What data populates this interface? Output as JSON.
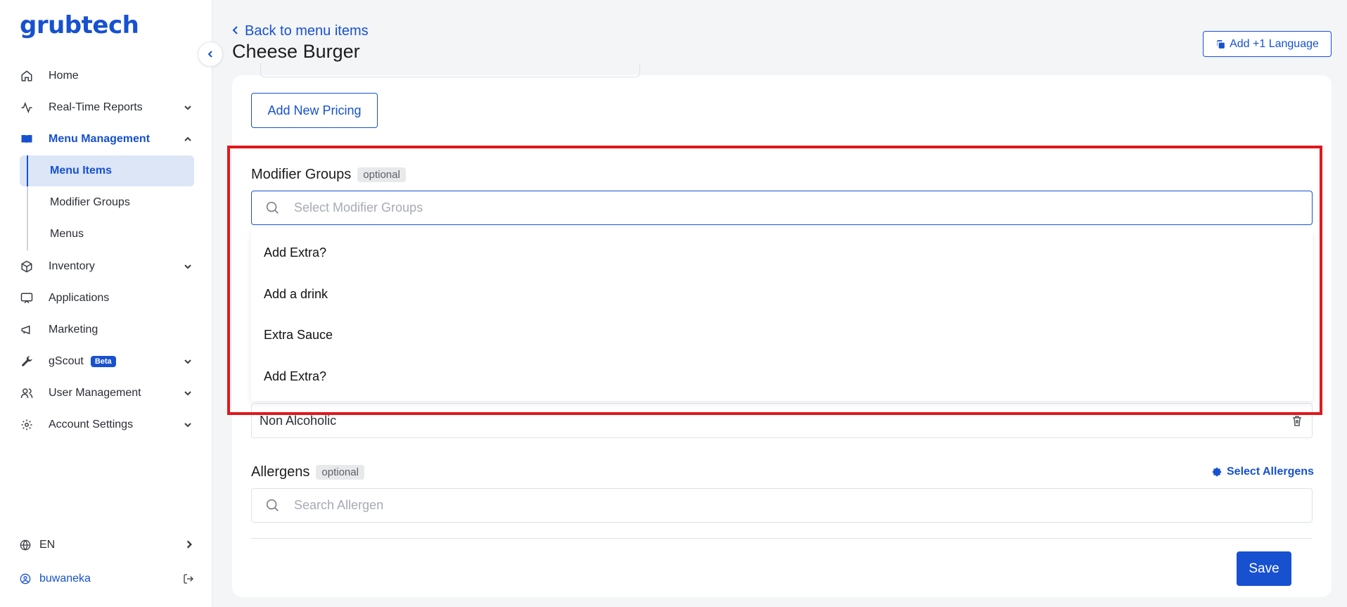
{
  "app": {
    "logo_text": "grubtech"
  },
  "sidebar": {
    "items": [
      {
        "label": "Home",
        "icon": "home-icon"
      },
      {
        "label": "Real-Time Reports",
        "icon": "activity-icon"
      },
      {
        "label": "Menu Management",
        "icon": "book-open-icon"
      },
      {
        "label": "Inventory",
        "icon": "box-icon"
      },
      {
        "label": "Applications",
        "icon": "monitor-icon"
      },
      {
        "label": "Marketing",
        "icon": "megaphone-icon"
      },
      {
        "label": "gScout",
        "icon": "wrench-icon",
        "badge": "Beta"
      },
      {
        "label": "User Management",
        "icon": "users-icon"
      },
      {
        "label": "Account Settings",
        "icon": "gear-icon"
      }
    ],
    "sub_items": [
      {
        "label": "Menu Items"
      },
      {
        "label": "Modifier Groups"
      },
      {
        "label": "Menus"
      }
    ],
    "language": "EN",
    "user": "buwaneka"
  },
  "header": {
    "back_label": "Back to menu items",
    "title": "Cheese Burger",
    "add_language_label": "Add +1 Language"
  },
  "form": {
    "add_pricing_label": "Add New Pricing",
    "modifier_groups": {
      "label": "Modifier Groups",
      "optional_badge": "optional",
      "placeholder": "Select Modifier Groups",
      "options": [
        "Add Extra?",
        "Add a drink",
        "Extra Sauce",
        "Add Extra?"
      ],
      "selected": "Non Alcoholic"
    },
    "allergens": {
      "label": "Allergens",
      "optional_badge": "optional",
      "select_label": "Select Allergens",
      "placeholder": "Search Allergen"
    },
    "save_label": "Save"
  },
  "colors": {
    "accent": "#1751d0",
    "highlight": "#e0181b",
    "selected_bg": "#dce6f7"
  }
}
